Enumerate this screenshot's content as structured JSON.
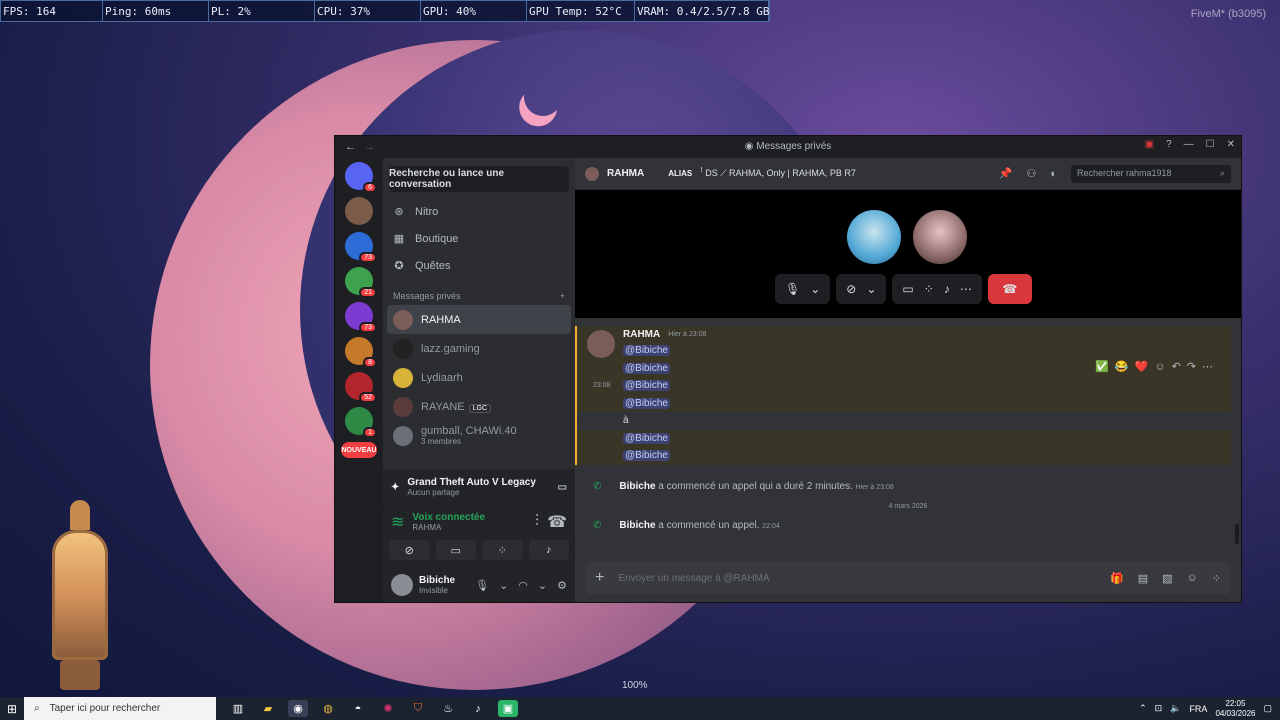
{
  "overlay": {
    "stats": [
      "FPS: 164",
      "Ping: 60ms",
      "PL: 2%",
      "CPU: 37%",
      "GPU: 40%",
      "GPU Temp: 52°C",
      "VRAM: 0.4/2.5/7.8 GB"
    ],
    "fivem": "FiveM* (b3095)",
    "zoom": "100%"
  },
  "window": {
    "title": "Messages privés"
  },
  "servers": [
    {
      "label": "",
      "badge": "6",
      "color": "#5865f2"
    },
    {
      "label": "",
      "badge": "",
      "color": "#7b5b49"
    },
    {
      "label": "",
      "badge": "73",
      "color": "#2d6bd6"
    },
    {
      "label": "",
      "badge": "21",
      "color": "#3fa34d"
    },
    {
      "label": "",
      "badge": "73",
      "color": "#7c3bd1"
    },
    {
      "label": "",
      "badge": "8",
      "color": "#c47a2a"
    },
    {
      "label": "",
      "badge": "52",
      "color": "#b2262c"
    },
    {
      "label": "",
      "badge": "1",
      "color": "#2f8a45"
    }
  ],
  "new_badge": "NOUVEAU",
  "sidebar": {
    "search": "Recherche ou lance une conversation",
    "nav": [
      {
        "label": "Nitro",
        "icon": "nitro-icon",
        "glyph": "⊛"
      },
      {
        "label": "Boutique",
        "icon": "shop-icon",
        "glyph": "▦"
      },
      {
        "label": "Quêtes",
        "icon": "quests-icon",
        "glyph": "✪"
      }
    ],
    "dm_header": "Messages privés",
    "dms": [
      {
        "name": "RAHMA",
        "tag": "",
        "sub": "",
        "active": true,
        "color": "#7a5c58"
      },
      {
        "name": "lazz.gaming",
        "tag": "",
        "sub": "",
        "active": false,
        "color": "#222"
      },
      {
        "name": "Lydiaarh",
        "tag": "",
        "sub": "",
        "active": false,
        "color": "#d7b339"
      },
      {
        "name": "RAYANE",
        "tag": "LGC",
        "sub": "",
        "active": false,
        "color": "#5c3b3b"
      },
      {
        "name": "gumball, CHAWi.40",
        "tag": "",
        "sub": "3 membres",
        "active": false,
        "color": "#6a6f78"
      }
    ]
  },
  "activity": {
    "game": "Grand Theft Auto V Legacy",
    "game_sub": "Aucun partage",
    "voice_status": "Voix connectée",
    "voice_user": "RAHMA"
  },
  "user": {
    "name": "Bibiche",
    "status": "Invisible"
  },
  "chat": {
    "header_name": "RAHMA",
    "alias_label": "ALIAS",
    "alias_value": "ꜝ DS ⟋ RAHMA, Only | RAHMA, PB R7",
    "search_placeholder": "Rechercher rahma1918",
    "message": {
      "author": "RAHMA",
      "time": "Hier à 23:08",
      "side_time": "23:08",
      "lines": [
        "@Bibiche",
        "@Bibiche",
        "@Bibiche",
        "@Bibiche",
        "à",
        "@Bibiche",
        "@Bibiche"
      ]
    },
    "reactions": [
      "✅",
      "😂",
      "❤️"
    ],
    "system1": {
      "user": "Bibiche",
      "text": "a commencé un appel qui a duré 2 minutes.",
      "time": "Hier à 23:08"
    },
    "date_divider": "4 mars 2026",
    "system2": {
      "user": "Bibiche",
      "text": "a commencé un appel.",
      "time": "22:04"
    },
    "composer_placeholder": "Envoyer un message à @RAHMA"
  },
  "taskbar": {
    "search": "Taper ici pour rechercher",
    "lang": "FRA",
    "time": "22:05",
    "date": "04/03/2026"
  }
}
